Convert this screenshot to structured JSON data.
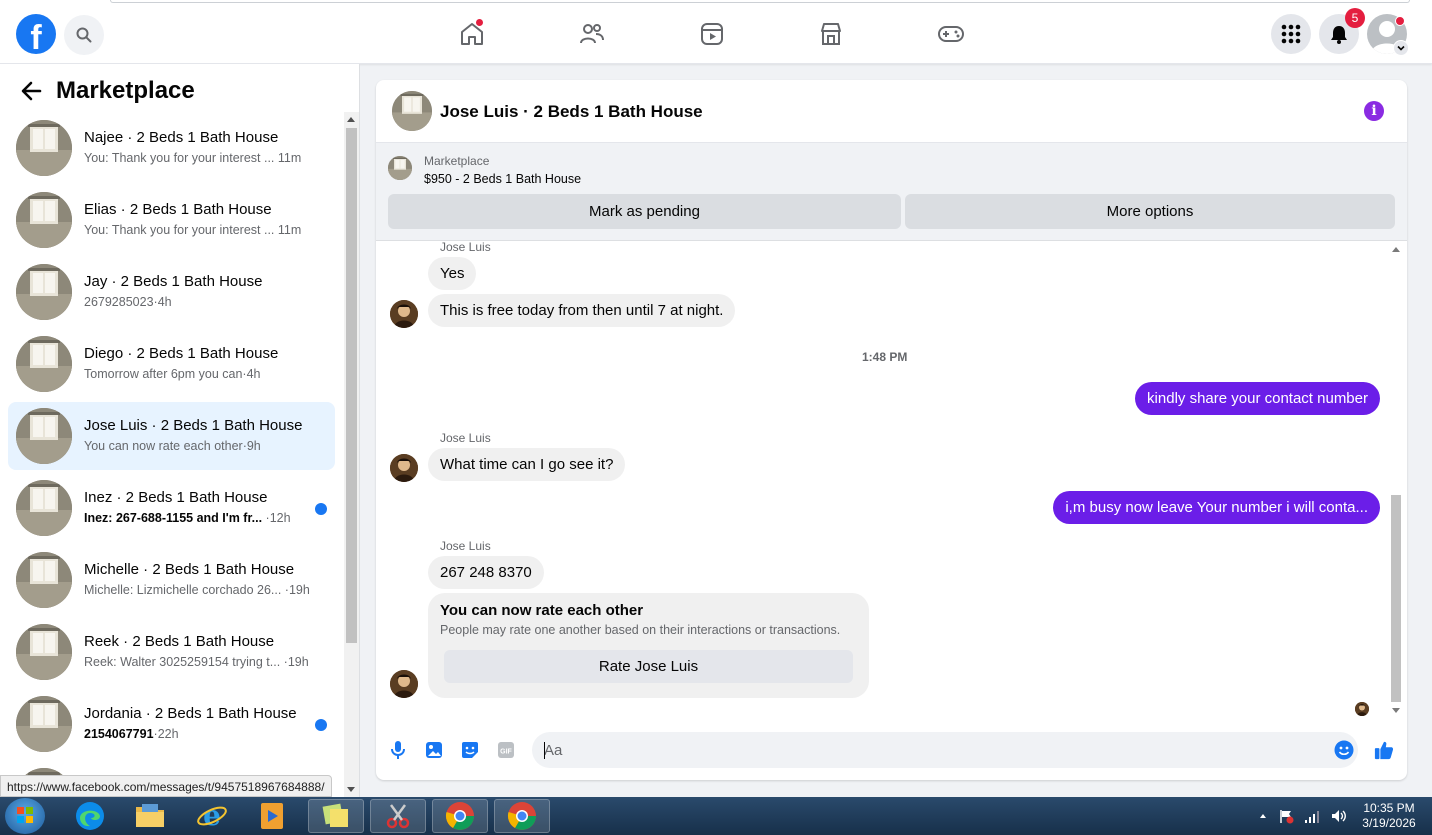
{
  "browser": {
    "status_url": "https://www.facebook.com/messages/t/9457518967684888/"
  },
  "topbar": {
    "logo_icon": "facebook-logo-icon",
    "notification_count": "5",
    "nav_icons": [
      "home-icon",
      "friends-icon",
      "video-icon",
      "marketplace-icon",
      "gaming-icon"
    ],
    "accent": "#1877f2",
    "badge_color": "#e41e3f"
  },
  "sidebar": {
    "title": "Marketplace",
    "conversations": [
      {
        "name": "Najee · 2 Beds 1 Bath House",
        "preview": "You: Thank you for your interest ...",
        "time": " 11m",
        "unread": false,
        "active": false
      },
      {
        "name": "Elias · 2 Beds 1 Bath House",
        "preview": "You: Thank you for your interest ...",
        "time": " 11m",
        "unread": false,
        "active": false
      },
      {
        "name": "Jay · 2 Beds 1 Bath House",
        "preview": "2679285023",
        "time": "·4h",
        "unread": false,
        "active": false
      },
      {
        "name": "Diego · 2 Beds 1 Bath House",
        "preview": "Tomorrow after 6pm you can",
        "time": "·4h",
        "unread": false,
        "active": false
      },
      {
        "name": "Jose Luis · 2 Beds 1 Bath House",
        "preview": "You can now rate each other",
        "time": "·9h",
        "unread": false,
        "active": true
      },
      {
        "name": "Inez · 2 Beds 1 Bath House",
        "preview": "Inez: 267-688-1155 and I'm fr...",
        "time": " ·12h",
        "unread": true,
        "active": false
      },
      {
        "name": "Michelle · 2 Beds 1 Bath House",
        "preview": "Michelle: Lizmichelle corchado 26...",
        "time": " ·19h",
        "unread": false,
        "active": false
      },
      {
        "name": "Reek · 2 Beds 1 Bath House",
        "preview": "Reek: Walter 3025259154 trying t...",
        "time": " ·19h",
        "unread": false,
        "active": false
      },
      {
        "name": "Jordania · 2 Beds 1 Bath House",
        "preview": "2154067791",
        "time": "·22h",
        "unread": true,
        "active": false
      }
    ]
  },
  "chat": {
    "title": "Jose Luis · 2 Beds 1 Bath House",
    "listing": {
      "label": "Marketplace",
      "price_title": "$950 - 2 Beds 1 Bath House",
      "mark_pending": "Mark as pending",
      "more_options": "More options"
    },
    "messages": {
      "sender1": "Jose Luis",
      "m1": "Yes",
      "m2": "This is free today from then until 7 at night.",
      "timestamp": "1:48 PM",
      "out1": "kindly share your contact number",
      "sender2": "Jose Luis",
      "m3": "What time can I go see it?",
      "out2": "i,m busy now leave Your number i will conta...",
      "sender3": "Jose Luis",
      "m4": "267 248 8370",
      "rate_title": "You can now rate each other",
      "rate_sub": "People may rate one another based on their interactions or transactions.",
      "rate_button": "Rate Jose Luis"
    },
    "composer": {
      "placeholder": "Aa"
    },
    "outgoing_color": "#6b1ee8"
  },
  "taskbar": {
    "time": "10:35 PM",
    "date": "3/19/2026"
  }
}
